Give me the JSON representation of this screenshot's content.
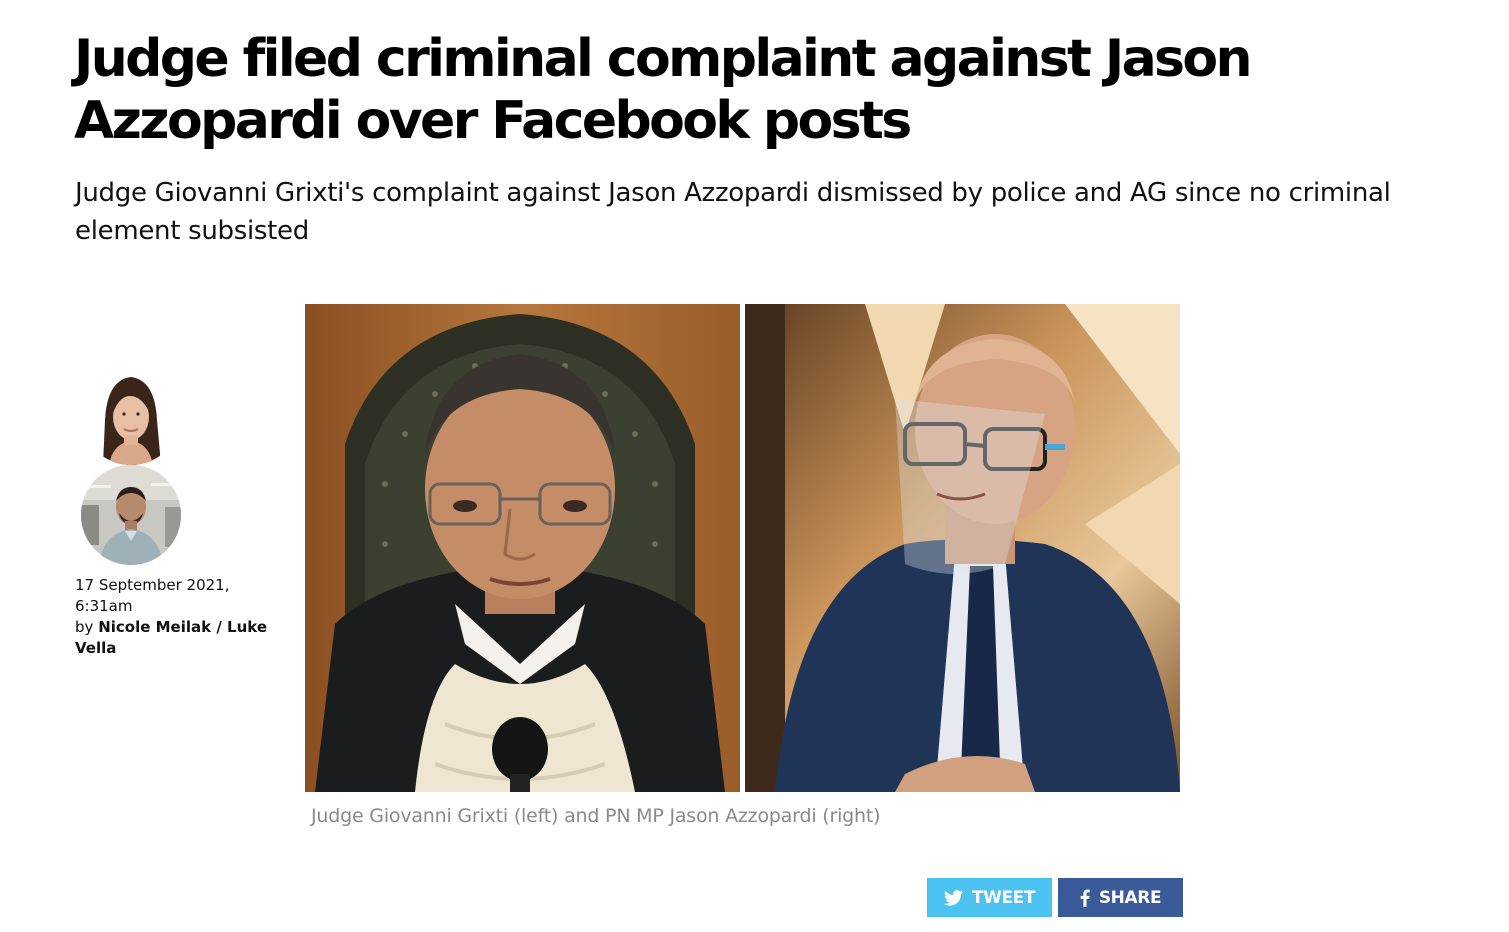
{
  "article": {
    "headline": "Judge filed criminal complaint against Jason Azzopardi over Facebook posts",
    "standfirst": "Judge Giovanni Grixti's complaint against Jason Azzopardi dismissed by police and AG since no criminal element subsisted",
    "date": "17 September 2021, 6:31am",
    "by_prefix": "by",
    "authors": "Nicole Meilak / Luke Vella",
    "image_caption": "Judge Giovanni Grixti (left) and PN MP Jason Azzopardi (right)"
  },
  "share": {
    "tweet_label": "TWEET",
    "share_label": "SHARE",
    "tweet_icon": "twitter-bird-icon",
    "share_icon": "facebook-f-icon",
    "tweet_color": "#4cc2f0",
    "share_color": "#3a5a99"
  }
}
